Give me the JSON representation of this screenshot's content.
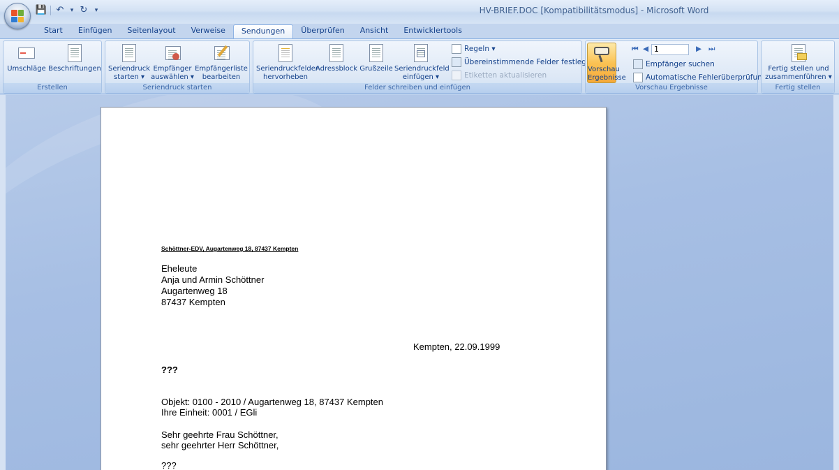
{
  "window": {
    "title": "HV-BRIEF.DOC [Kompatibilitätsmodus] - Microsoft Word"
  },
  "quick_access": {
    "save": "💾",
    "undo": "↶",
    "undo_dropdown": "▾",
    "redo": "↻",
    "customize": "▾"
  },
  "tabs": [
    "Start",
    "Einfügen",
    "Seitenlayout",
    "Verweise",
    "Sendungen",
    "Überprüfen",
    "Ansicht",
    "Entwicklertools"
  ],
  "active_tab": "Sendungen",
  "ribbon": {
    "erstellen": {
      "label": "Erstellen",
      "umschlaege": "Umschläge",
      "beschriftungen": "Beschriftungen"
    },
    "seriendruck_starten": {
      "label": "Seriendruck starten",
      "seriendruck_l1": "Seriendruck",
      "seriendruck_l2": "starten ▾",
      "empfaenger_l1": "Empfänger",
      "empfaenger_l2": "auswählen ▾",
      "liste_l1": "Empfängerliste",
      "liste_l2": "bearbeiten"
    },
    "felder": {
      "label": "Felder schreiben und einfügen",
      "hervorheben_l1": "Seriendruckfelder",
      "hervorheben_l2": "hervorheben",
      "adressblock": "Adressblock",
      "grusszeile": "Grußzeile",
      "feld_l1": "Seriendruckfeld",
      "feld_l2": "einfügen ▾",
      "regeln": "Regeln ▾",
      "uebereinstimmende": "Übereinstimmende Felder festlegen",
      "etiketten": "Etiketten aktualisieren"
    },
    "vorschau": {
      "label": "Vorschau Ergebnisse",
      "vorschau_l1": "Vorschau",
      "vorschau_l2": "Ergebnisse",
      "record": "1",
      "empfaenger_suchen": "Empfänger suchen",
      "fehlerpruefung": "Automatische Fehlerüberprüfung"
    },
    "fertig": {
      "label": "Fertig stellen",
      "fertig_l1": "Fertig stellen und",
      "fertig_l2": "zusammenführen ▾"
    }
  },
  "document": {
    "sender_line": "Schöttner-EDV, Augartenweg 18, 87437 Kempten",
    "address": [
      "Eheleute",
      "Anja und Armin Schöttner",
      "Augartenweg 18",
      "87437 Kempten"
    ],
    "date": "Kempten, 22.09.1999",
    "placeholder1": "???",
    "objekt": "Objekt: 0100 - 2010 / Augartenweg 18, 87437 Kempten",
    "einheit": "Ihre Einheit: 0001 / EGli",
    "greeting1": "Sehr geehrte Frau Schöttner,",
    "greeting2": "sehr geehrter Herr Schöttner,",
    "placeholder2": "???"
  },
  "colors": {
    "ribbon_text": "#15428b",
    "active_button": "#fbc354",
    "workspace": "#a7bfe4"
  }
}
